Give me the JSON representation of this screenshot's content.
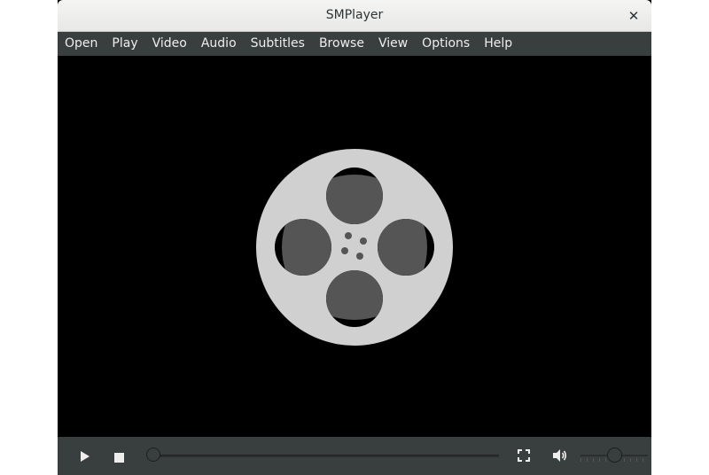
{
  "window": {
    "title": "SMPlayer"
  },
  "menubar": {
    "items": [
      "Open",
      "Play",
      "Video",
      "Audio",
      "Subtitles",
      "Browse",
      "View",
      "Options",
      "Help"
    ]
  },
  "controls": {
    "seek_position": 0,
    "volume_level": 0.5
  },
  "icons": {
    "close": "close-icon",
    "play": "play-icon",
    "stop": "stop-icon",
    "fullscreen": "fullscreen-icon",
    "volume": "volume-icon",
    "placeholder": "film-reel-icon"
  },
  "colors": {
    "menubar_bg": "#393f3f",
    "video_bg": "#000000",
    "reel_outer": "#d0d0d0",
    "reel_hole": "#555555"
  }
}
